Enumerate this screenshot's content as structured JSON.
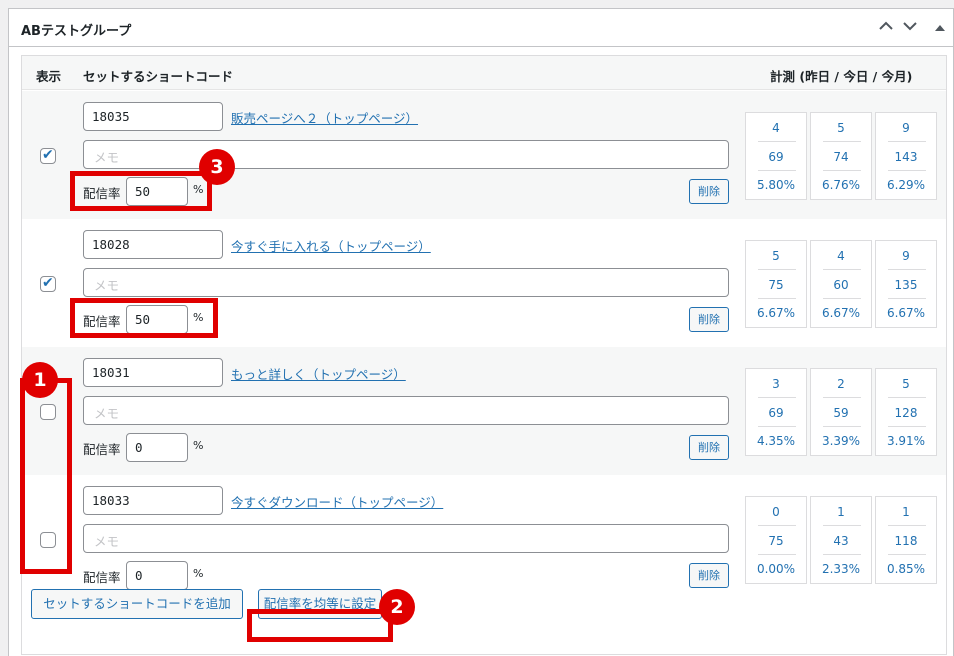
{
  "panel": {
    "title": "ABテストグループ",
    "controls": {
      "up_icon": "chevron-up-icon",
      "down_icon": "chevron-down-icon",
      "toggle_icon": "triangle-up-icon"
    }
  },
  "table": {
    "headers": {
      "show": "表示",
      "shortcode": "セットするショートコード",
      "stats": "計測 (昨日 / 今日 / 今月)"
    },
    "memo_placeholder": "メモ",
    "rate_label": "配信率",
    "percent": "%",
    "delete_label": "削除",
    "rows": [
      {
        "checked": true,
        "shortcode": "18035",
        "link": "販売ページへ２（トップページ）",
        "rate": "50",
        "stats": [
          {
            "a": "4",
            "b": "69",
            "c": "5.80%"
          },
          {
            "a": "5",
            "b": "74",
            "c": "6.76%"
          },
          {
            "a": "9",
            "b": "143",
            "c": "6.29%"
          }
        ]
      },
      {
        "checked": true,
        "shortcode": "18028",
        "link": "今すぐ手に入れる（トップページ）",
        "rate": "50",
        "stats": [
          {
            "a": "5",
            "b": "75",
            "c": "6.67%"
          },
          {
            "a": "4",
            "b": "60",
            "c": "6.67%"
          },
          {
            "a": "9",
            "b": "135",
            "c": "6.67%"
          }
        ]
      },
      {
        "checked": false,
        "shortcode": "18031",
        "link": "もっと詳しく（トップページ）",
        "rate": "0",
        "stats": [
          {
            "a": "3",
            "b": "69",
            "c": "4.35%"
          },
          {
            "a": "2",
            "b": "59",
            "c": "3.39%"
          },
          {
            "a": "5",
            "b": "128",
            "c": "3.91%"
          }
        ]
      },
      {
        "checked": false,
        "shortcode": "18033",
        "link": "今すぐダウンロード（トップページ）",
        "rate": "0",
        "stats": [
          {
            "a": "0",
            "b": "75",
            "c": "0.00%"
          },
          {
            "a": "1",
            "b": "43",
            "c": "2.33%"
          },
          {
            "a": "1",
            "b": "118",
            "c": "0.85%"
          }
        ]
      }
    ]
  },
  "footer": {
    "add_button": "セットするショートコードを追加",
    "equalize_button": "配信率を均等に設定"
  },
  "annotations": {
    "badge1": "1",
    "badge2": "2",
    "badge3": "3",
    "color": "#e00000"
  }
}
